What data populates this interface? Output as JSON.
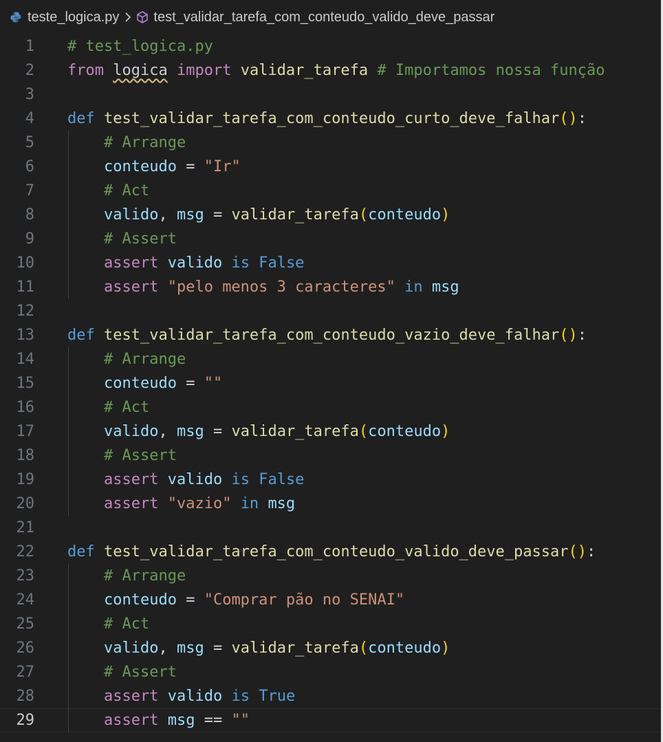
{
  "breadcrumb": {
    "file_name": "teste_logica.py",
    "symbol_name": "test_validar_tarefa_com_conteudo_valido_deve_passar",
    "file_icon": "python-file-icon",
    "symbol_icon": "method-cube-icon",
    "separator_icon": "chevron-right-icon"
  },
  "editor": {
    "current_line": 29,
    "colors": {
      "background": "#1f1f1f",
      "comment": "#6a9955",
      "keyword": "#569cd6",
      "control": "#c586c0",
      "function": "#dcdcaa",
      "variable": "#9cdcfe",
      "string": "#ce9178",
      "bracket": "#ffd700"
    },
    "lines": [
      {
        "n": "1",
        "tokens": [
          {
            "t": "# test_logica.py",
            "c": "cm"
          }
        ]
      },
      {
        "n": "2",
        "tokens": [
          {
            "t": "from",
            "c": "ctl"
          },
          {
            "t": " ",
            "c": "plain"
          },
          {
            "t": "logica",
            "c": "mod"
          },
          {
            "t": " ",
            "c": "plain"
          },
          {
            "t": "import",
            "c": "ctl"
          },
          {
            "t": " ",
            "c": "plain"
          },
          {
            "t": "validar_tarefa",
            "c": "fn"
          },
          {
            "t": " ",
            "c": "plain"
          },
          {
            "t": "# Importamos nossa função",
            "c": "cm"
          }
        ]
      },
      {
        "n": "3",
        "tokens": []
      },
      {
        "n": "4",
        "tokens": [
          {
            "t": "def",
            "c": "kw"
          },
          {
            "t": " ",
            "c": "plain"
          },
          {
            "t": "test_validar_tarefa_com_conteudo_curto_deve_falhar",
            "c": "fn"
          },
          {
            "t": "()",
            "c": "br"
          },
          {
            "t": ":",
            "c": "plain"
          }
        ]
      },
      {
        "n": "5",
        "tokens": [
          {
            "t": "    ",
            "c": "plain"
          },
          {
            "t": "# Arrange",
            "c": "cm"
          }
        ]
      },
      {
        "n": "6",
        "tokens": [
          {
            "t": "    ",
            "c": "plain"
          },
          {
            "t": "conteudo",
            "c": "var"
          },
          {
            "t": " = ",
            "c": "op"
          },
          {
            "t": "\"Ir\"",
            "c": "str"
          }
        ]
      },
      {
        "n": "7",
        "tokens": [
          {
            "t": "    ",
            "c": "plain"
          },
          {
            "t": "# Act",
            "c": "cm"
          }
        ]
      },
      {
        "n": "8",
        "tokens": [
          {
            "t": "    ",
            "c": "plain"
          },
          {
            "t": "valido",
            "c": "var"
          },
          {
            "t": ", ",
            "c": "plain"
          },
          {
            "t": "msg",
            "c": "var"
          },
          {
            "t": " = ",
            "c": "op"
          },
          {
            "t": "validar_tarefa",
            "c": "fn"
          },
          {
            "t": "(",
            "c": "br"
          },
          {
            "t": "conteudo",
            "c": "var"
          },
          {
            "t": ")",
            "c": "br"
          }
        ]
      },
      {
        "n": "9",
        "tokens": [
          {
            "t": "    ",
            "c": "plain"
          },
          {
            "t": "# Assert",
            "c": "cm"
          }
        ]
      },
      {
        "n": "10",
        "tokens": [
          {
            "t": "    ",
            "c": "plain"
          },
          {
            "t": "assert",
            "c": "ctl"
          },
          {
            "t": " ",
            "c": "plain"
          },
          {
            "t": "valido",
            "c": "var"
          },
          {
            "t": " ",
            "c": "plain"
          },
          {
            "t": "is",
            "c": "kw"
          },
          {
            "t": " ",
            "c": "plain"
          },
          {
            "t": "False",
            "c": "kw"
          }
        ]
      },
      {
        "n": "11",
        "tokens": [
          {
            "t": "    ",
            "c": "plain"
          },
          {
            "t": "assert",
            "c": "ctl"
          },
          {
            "t": " ",
            "c": "plain"
          },
          {
            "t": "\"pelo menos 3 caracteres\"",
            "c": "str"
          },
          {
            "t": " ",
            "c": "plain"
          },
          {
            "t": "in",
            "c": "kw"
          },
          {
            "t": " ",
            "c": "plain"
          },
          {
            "t": "msg",
            "c": "var"
          }
        ]
      },
      {
        "n": "12",
        "tokens": []
      },
      {
        "n": "13",
        "tokens": [
          {
            "t": "def",
            "c": "kw"
          },
          {
            "t": " ",
            "c": "plain"
          },
          {
            "t": "test_validar_tarefa_com_conteudo_vazio_deve_falhar",
            "c": "fn"
          },
          {
            "t": "()",
            "c": "br"
          },
          {
            "t": ":",
            "c": "plain"
          }
        ]
      },
      {
        "n": "14",
        "tokens": [
          {
            "t": "    ",
            "c": "plain"
          },
          {
            "t": "# Arrange",
            "c": "cm"
          }
        ]
      },
      {
        "n": "15",
        "tokens": [
          {
            "t": "    ",
            "c": "plain"
          },
          {
            "t": "conteudo",
            "c": "var"
          },
          {
            "t": " = ",
            "c": "op"
          },
          {
            "t": "\"\"",
            "c": "str"
          }
        ]
      },
      {
        "n": "16",
        "tokens": [
          {
            "t": "    ",
            "c": "plain"
          },
          {
            "t": "# Act",
            "c": "cm"
          }
        ]
      },
      {
        "n": "17",
        "tokens": [
          {
            "t": "    ",
            "c": "plain"
          },
          {
            "t": "valido",
            "c": "var"
          },
          {
            "t": ", ",
            "c": "plain"
          },
          {
            "t": "msg",
            "c": "var"
          },
          {
            "t": " = ",
            "c": "op"
          },
          {
            "t": "validar_tarefa",
            "c": "fn"
          },
          {
            "t": "(",
            "c": "br"
          },
          {
            "t": "conteudo",
            "c": "var"
          },
          {
            "t": ")",
            "c": "br"
          }
        ]
      },
      {
        "n": "18",
        "tokens": [
          {
            "t": "    ",
            "c": "plain"
          },
          {
            "t": "# Assert",
            "c": "cm"
          }
        ]
      },
      {
        "n": "19",
        "tokens": [
          {
            "t": "    ",
            "c": "plain"
          },
          {
            "t": "assert",
            "c": "ctl"
          },
          {
            "t": " ",
            "c": "plain"
          },
          {
            "t": "valido",
            "c": "var"
          },
          {
            "t": " ",
            "c": "plain"
          },
          {
            "t": "is",
            "c": "kw"
          },
          {
            "t": " ",
            "c": "plain"
          },
          {
            "t": "False",
            "c": "kw"
          }
        ]
      },
      {
        "n": "20",
        "tokens": [
          {
            "t": "    ",
            "c": "plain"
          },
          {
            "t": "assert",
            "c": "ctl"
          },
          {
            "t": " ",
            "c": "plain"
          },
          {
            "t": "\"vazio\"",
            "c": "str"
          },
          {
            "t": " ",
            "c": "plain"
          },
          {
            "t": "in",
            "c": "kw"
          },
          {
            "t": " ",
            "c": "plain"
          },
          {
            "t": "msg",
            "c": "var"
          }
        ]
      },
      {
        "n": "21",
        "tokens": []
      },
      {
        "n": "22",
        "tokens": [
          {
            "t": "def",
            "c": "kw"
          },
          {
            "t": " ",
            "c": "plain"
          },
          {
            "t": "test_validar_tarefa_com_conteudo_valido_deve_passar",
            "c": "fn"
          },
          {
            "t": "()",
            "c": "br"
          },
          {
            "t": ":",
            "c": "plain"
          }
        ]
      },
      {
        "n": "23",
        "tokens": [
          {
            "t": "    ",
            "c": "plain"
          },
          {
            "t": "# Arrange",
            "c": "cm"
          }
        ]
      },
      {
        "n": "24",
        "tokens": [
          {
            "t": "    ",
            "c": "plain"
          },
          {
            "t": "conteudo",
            "c": "var"
          },
          {
            "t": " = ",
            "c": "op"
          },
          {
            "t": "\"Comprar pão no SENAI\"",
            "c": "str"
          }
        ]
      },
      {
        "n": "25",
        "tokens": [
          {
            "t": "    ",
            "c": "plain"
          },
          {
            "t": "# Act",
            "c": "cm"
          }
        ]
      },
      {
        "n": "26",
        "tokens": [
          {
            "t": "    ",
            "c": "plain"
          },
          {
            "t": "valido",
            "c": "var"
          },
          {
            "t": ", ",
            "c": "plain"
          },
          {
            "t": "msg",
            "c": "var"
          },
          {
            "t": " = ",
            "c": "op"
          },
          {
            "t": "validar_tarefa",
            "c": "fn"
          },
          {
            "t": "(",
            "c": "br"
          },
          {
            "t": "conteudo",
            "c": "var"
          },
          {
            "t": ")",
            "c": "br"
          }
        ]
      },
      {
        "n": "27",
        "tokens": [
          {
            "t": "    ",
            "c": "plain"
          },
          {
            "t": "# Assert",
            "c": "cm"
          }
        ]
      },
      {
        "n": "28",
        "tokens": [
          {
            "t": "    ",
            "c": "plain"
          },
          {
            "t": "assert",
            "c": "ctl"
          },
          {
            "t": " ",
            "c": "plain"
          },
          {
            "t": "valido",
            "c": "var"
          },
          {
            "t": " ",
            "c": "plain"
          },
          {
            "t": "is",
            "c": "kw"
          },
          {
            "t": " ",
            "c": "plain"
          },
          {
            "t": "True",
            "c": "kw"
          }
        ]
      },
      {
        "n": "29",
        "tokens": [
          {
            "t": "    ",
            "c": "plain"
          },
          {
            "t": "assert",
            "c": "ctl"
          },
          {
            "t": " ",
            "c": "plain"
          },
          {
            "t": "msg",
            "c": "var"
          },
          {
            "t": " == ",
            "c": "op"
          },
          {
            "t": "\"\"",
            "c": "str"
          }
        ]
      }
    ]
  }
}
